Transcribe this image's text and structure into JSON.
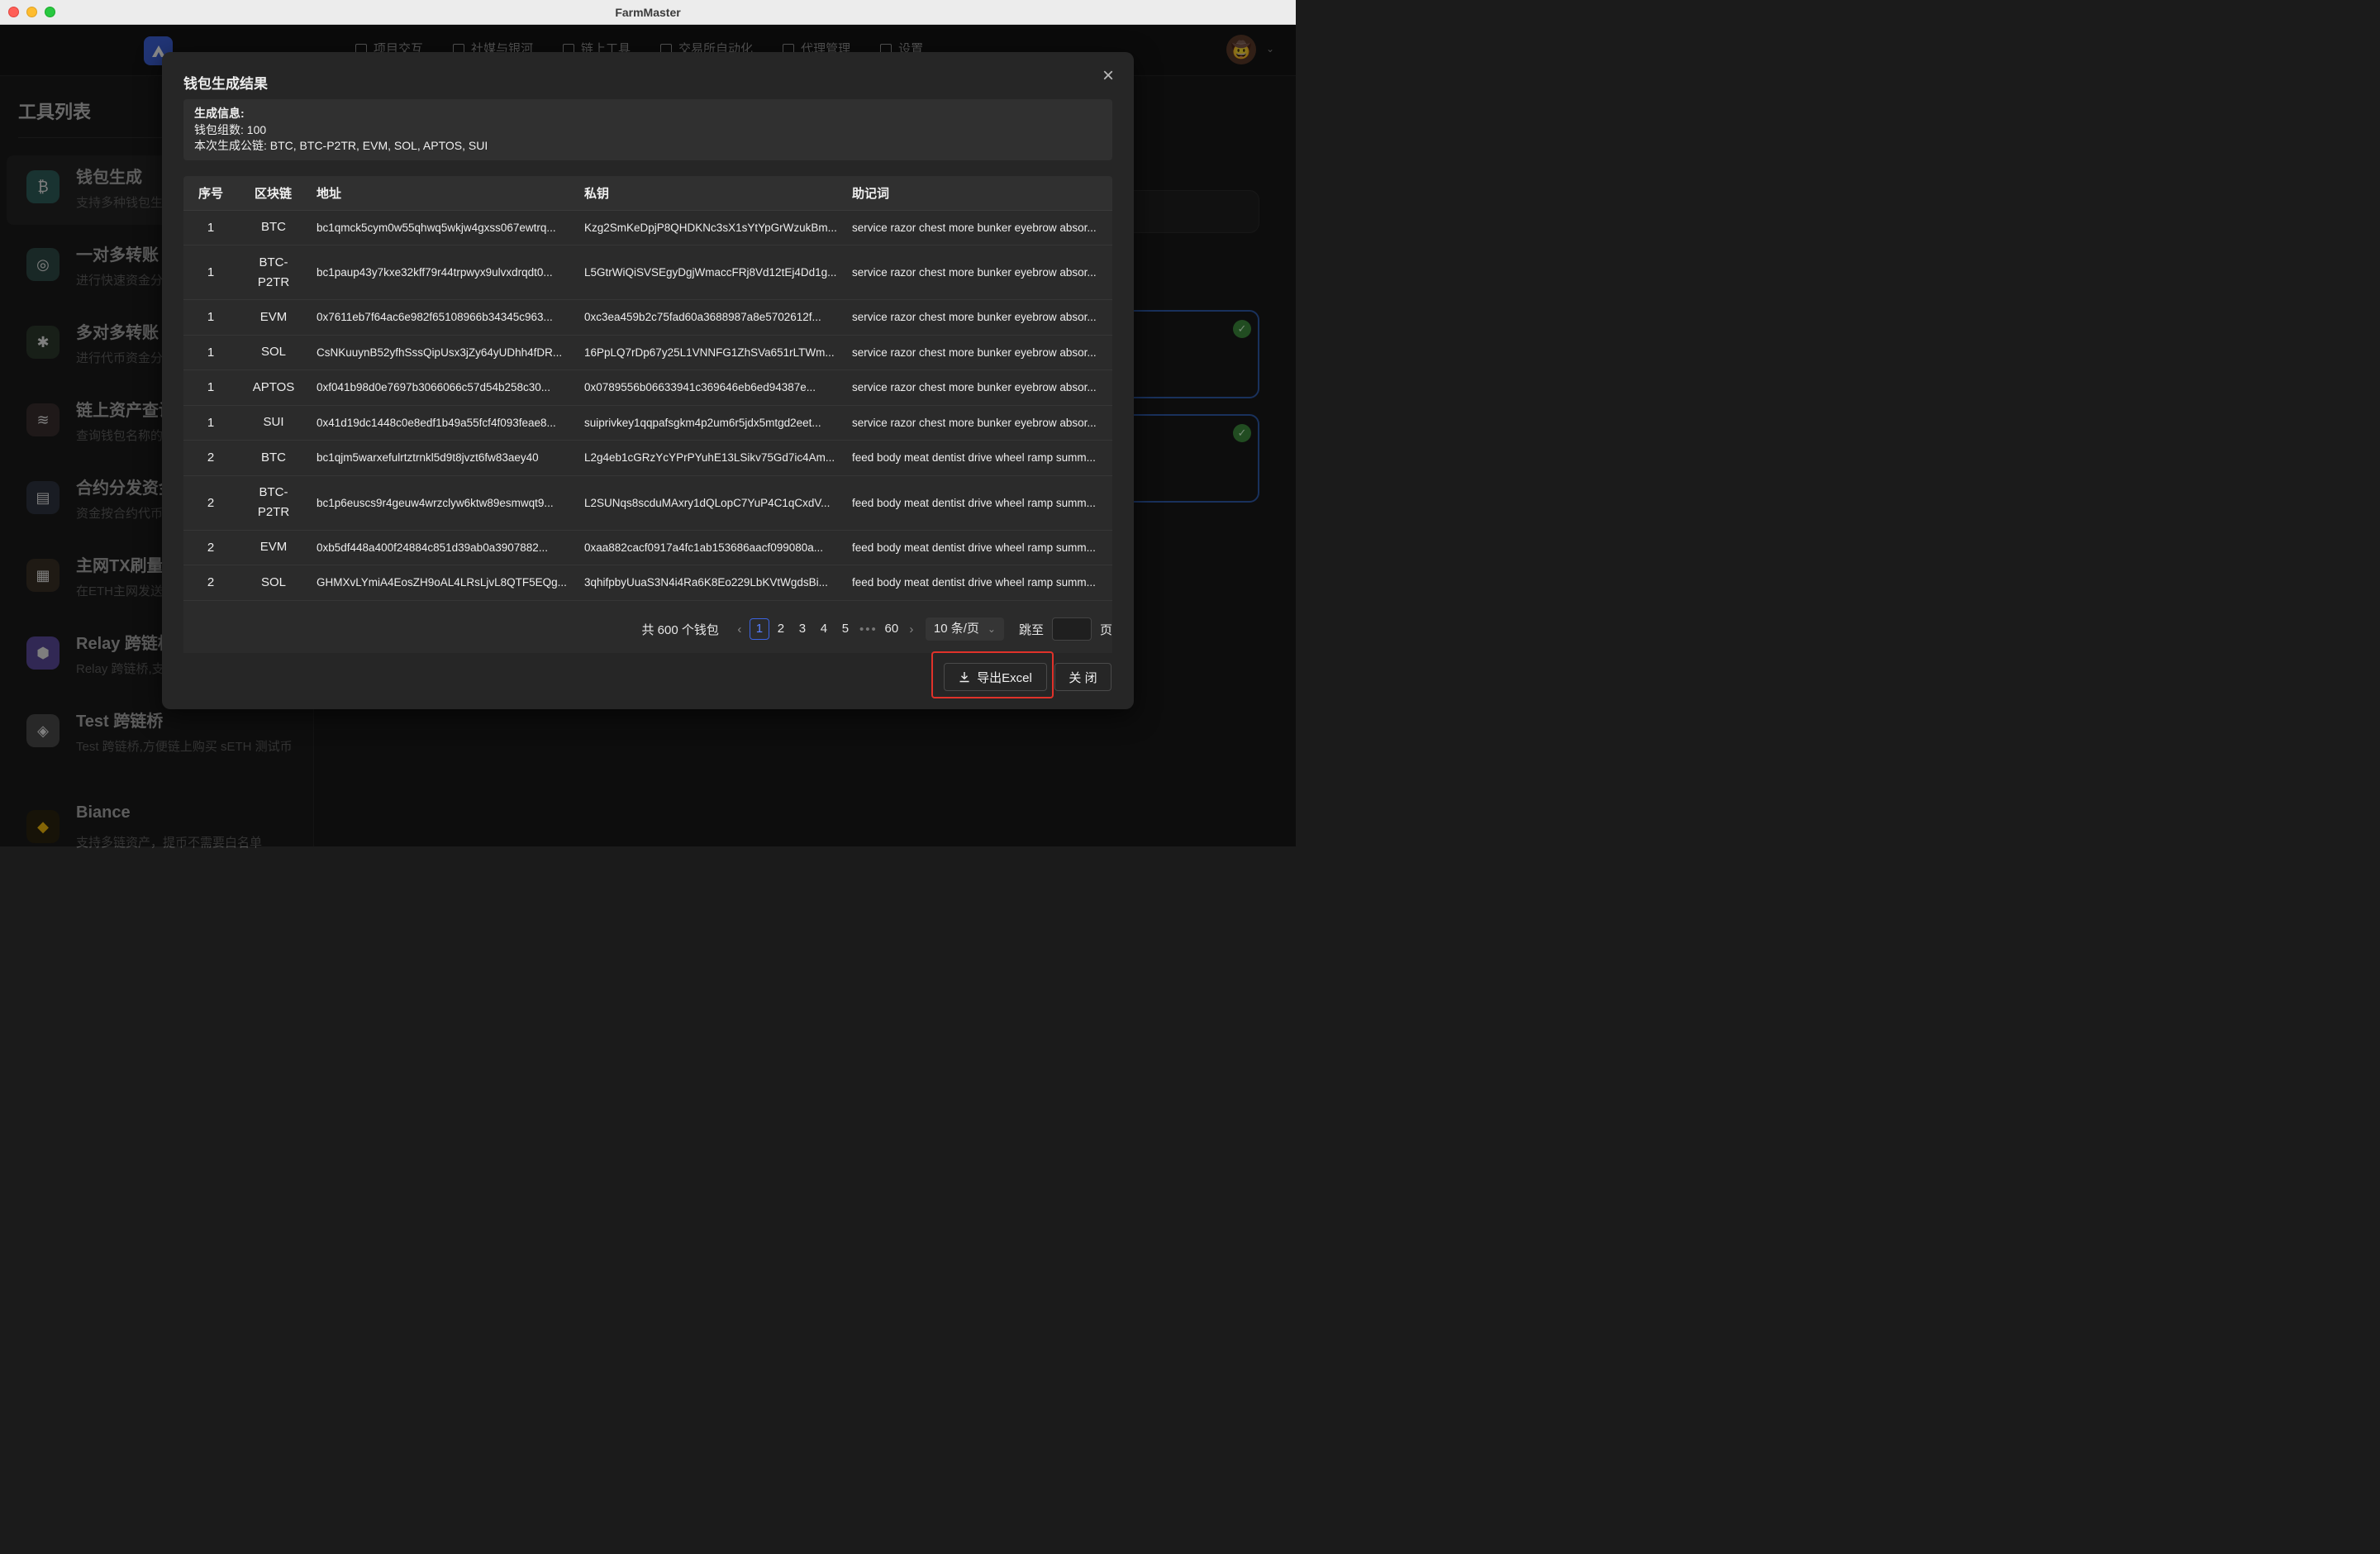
{
  "window": {
    "title": "FarmMaster"
  },
  "topnav": {
    "items": [
      "项目交互",
      "社媒与银河",
      "链上工具",
      "交易所自动化",
      "代理管理",
      "设置"
    ]
  },
  "sidebar": {
    "title": "工具列表",
    "tools": [
      {
        "name": "钱包生成",
        "desc": "支持多种钱包生成"
      },
      {
        "name": "一对多转账",
        "desc": "进行快速资金分发"
      },
      {
        "name": "多对多转账",
        "desc": "进行代币资金分发"
      },
      {
        "name": "链上资产查询",
        "desc": "查询钱包名称的资产"
      },
      {
        "name": "合约分发资金",
        "desc": "资金按合约代币分发"
      },
      {
        "name": "主网TX刷量",
        "desc": "在ETH主网发送交易"
      },
      {
        "name": "Relay 跨链桥",
        "desc": "Relay 跨链桥,支持多链"
      },
      {
        "name": "Test 跨链桥",
        "desc": "Test 跨链桥,方便链上购买 sETH 测试币"
      },
      {
        "name": "Biance",
        "desc": "支持多链资产，提币不需要白名单"
      }
    ]
  },
  "modal": {
    "title": "钱包生成结果",
    "info": {
      "head": "生成信息:",
      "count": "钱包组数: 100",
      "chains": "本次生成公链: BTC, BTC-P2TR, EVM, SOL, APTOS, SUI"
    },
    "table": {
      "headers": [
        "序号",
        "区块链",
        "地址",
        "私钥",
        "助记词"
      ],
      "rows": [
        {
          "idx": "1",
          "chain": "BTC",
          "addr": "bc1qmck5cym0w55qhwq5wkjw4gxss067ewtrq...",
          "key": "Kzg2SmKeDpjP8QHDKNc3sX1sYtYpGrWzukBm...",
          "mnemonic": "service razor chest more bunker eyebrow absor..."
        },
        {
          "idx": "1",
          "chain": "BTC-P2TR",
          "addr": "bc1paup43y7kxe32kff79r44trpwyx9ulvxdrqdt0...",
          "key": "L5GtrWiQiSVSEgyDgjWmaccFRj8Vd12tEj4Dd1g...",
          "mnemonic": "service razor chest more bunker eyebrow absor..."
        },
        {
          "idx": "1",
          "chain": "EVM",
          "addr": "0x7611eb7f64ac6e982f65108966b34345c963...",
          "key": "0xc3ea459b2c75fad60a3688987a8e5702612f...",
          "mnemonic": "service razor chest more bunker eyebrow absor..."
        },
        {
          "idx": "1",
          "chain": "SOL",
          "addr": "CsNKuuynB52yfhSssQipUsx3jZy64yUDhh4fDR...",
          "key": "16PpLQ7rDp67y25L1VNNFG1ZhSVa651rLTWm...",
          "mnemonic": "service razor chest more bunker eyebrow absor..."
        },
        {
          "idx": "1",
          "chain": "APTOS",
          "addr": "0xf041b98d0e7697b3066066c57d54b258c30...",
          "key": "0x0789556b06633941c369646eb6ed94387e...",
          "mnemonic": "service razor chest more bunker eyebrow absor..."
        },
        {
          "idx": "1",
          "chain": "SUI",
          "addr": "0x41d19dc1448c0e8edf1b49a55fcf4f093feae8...",
          "key": "suiprivkey1qqpafsgkm4p2um6r5jdx5mtgd2eet...",
          "mnemonic": "service razor chest more bunker eyebrow absor..."
        },
        {
          "idx": "2",
          "chain": "BTC",
          "addr": "bc1qjm5warxefulrtztrnkl5d9t8jvzt6fw83aey40",
          "key": "L2g4eb1cGRzYcYPrPYuhE13LSikv75Gd7ic4Am...",
          "mnemonic": "feed body meat dentist drive wheel ramp summ..."
        },
        {
          "idx": "2",
          "chain": "BTC-P2TR",
          "addr": "bc1p6euscs9r4geuw4wrzclyw6ktw89esmwqt9...",
          "key": "L2SUNqs8scduMAxry1dQLopC7YuP4C1qCxdV...",
          "mnemonic": "feed body meat dentist drive wheel ramp summ..."
        },
        {
          "idx": "2",
          "chain": "EVM",
          "addr": "0xb5df448a400f24884c851d39ab0a3907882...",
          "key": "0xaa882cacf0917a4fc1ab153686aacf099080a...",
          "mnemonic": "feed body meat dentist drive wheel ramp summ..."
        },
        {
          "idx": "2",
          "chain": "SOL",
          "addr": "GHMXvLYmiA4EosZH9oAL4LRsLjvL8QTF5EQg...",
          "key": "3qhifpbyUuaS3N4i4Ra6K8Eo229LbKVtWgdsBi...",
          "mnemonic": "feed body meat dentist drive wheel ramp summ..."
        }
      ]
    },
    "pagination": {
      "total": "共 600 个钱包",
      "pages": [
        "1",
        "2",
        "3",
        "4",
        "5"
      ],
      "current": "1",
      "ellipsis": "•••",
      "last": "60",
      "size": "10 条/页",
      "jump_label": "跳至",
      "page_unit": "页"
    },
    "buttons": {
      "export": "导出Excel",
      "close": "关 闭"
    }
  },
  "colors": {
    "accent": "#3c63e0",
    "highlight": "#e0322a",
    "success": "#3c8a3c"
  }
}
